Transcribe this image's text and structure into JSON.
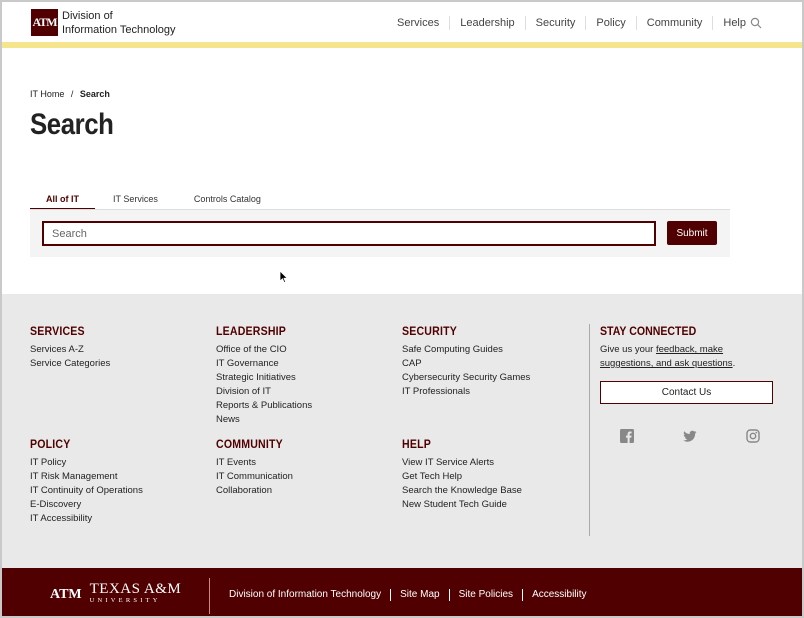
{
  "header": {
    "logo_mark": "ATM",
    "logo_line1": "Division of",
    "logo_line2": "Information Technology",
    "nav": [
      "Services",
      "Leadership",
      "Security",
      "Policy",
      "Community",
      "Help"
    ]
  },
  "breadcrumb": {
    "home": "IT Home",
    "separator": "/",
    "current": "Search"
  },
  "page_title": "Search",
  "tabs": [
    {
      "label": "All of IT",
      "active": true
    },
    {
      "label": "IT Services",
      "active": false
    },
    {
      "label": "Controls Catalog",
      "active": false
    }
  ],
  "search": {
    "placeholder": "Search",
    "value": "",
    "submit_label": "Submit"
  },
  "footer": {
    "services": {
      "title": "SERVICES",
      "links": [
        "Services A-Z",
        "Service Categories"
      ]
    },
    "leadership": {
      "title": "LEADERSHIP",
      "links": [
        "Office of the CIO",
        "IT Governance",
        "Strategic Initiatives",
        "Division of IT",
        "Reports & Publications",
        "News"
      ]
    },
    "security": {
      "title": "SECURITY",
      "links": [
        "Safe Computing Guides",
        "CAP",
        "Cybersecurity Security Games",
        "IT Professionals"
      ]
    },
    "policy": {
      "title": "POLICY",
      "links": [
        "IT Policy",
        "IT Risk Management",
        "IT Continuity of Operations",
        "E-Discovery",
        "IT Accessibility"
      ]
    },
    "community": {
      "title": "COMMUNITY",
      "links": [
        "IT Events",
        "IT Communication",
        "Collaboration"
      ]
    },
    "help": {
      "title": "HELP",
      "links": [
        "View IT Service Alerts",
        "Get Tech Help",
        "Search the Knowledge Base",
        "New Student Tech Guide"
      ]
    },
    "stay": {
      "title": "STAY CONNECTED",
      "text_before": "Give us your ",
      "link_text": "feedback, make suggestions, and ask questions",
      "text_after": ".",
      "button": "Contact Us"
    }
  },
  "bottom": {
    "logo_mark": "ATM",
    "logo_line1": "TEXAS A&M",
    "logo_line2": "UNIVERSITY",
    "links": [
      "Division of Information Technology",
      "Site Map",
      "Site Policies",
      "Accessibility"
    ]
  },
  "colors": {
    "maroon": "#500000",
    "gold": "#f5e58d",
    "footer_bg": "#e9e9e9"
  }
}
